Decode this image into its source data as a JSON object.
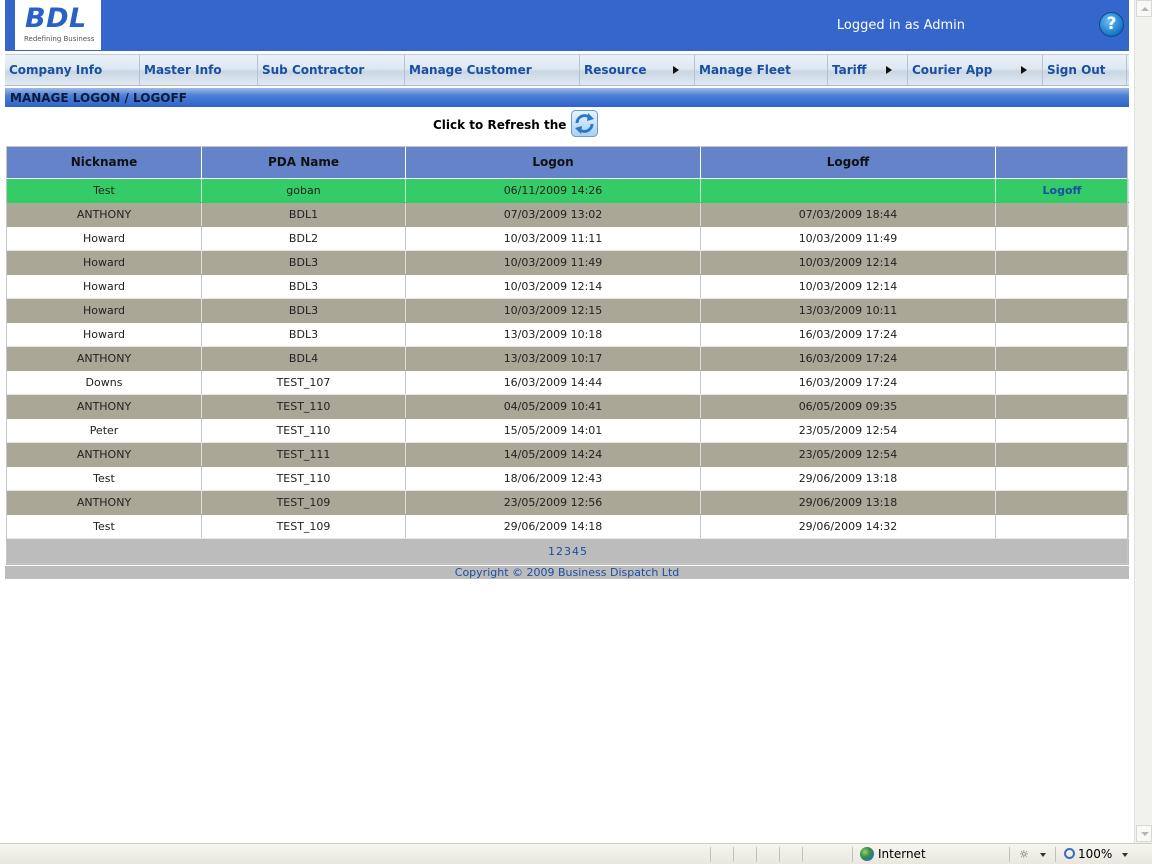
{
  "header": {
    "logo_text": "BDL",
    "logo_tagline": "Redefining Business",
    "logged_in_text": "Logged in as Admin",
    "help_label": "?"
  },
  "nav": {
    "items": [
      {
        "label": "Company Info",
        "has_submenu": false
      },
      {
        "label": "Master Info",
        "has_submenu": false
      },
      {
        "label": "Sub Contractor",
        "has_submenu": false
      },
      {
        "label": "Manage Customer",
        "has_submenu": false
      },
      {
        "label": "Resource",
        "has_submenu": true
      },
      {
        "label": "Manage Fleet",
        "has_submenu": false
      },
      {
        "label": "Tariff",
        "has_submenu": true
      },
      {
        "label": "Courier App",
        "has_submenu": true
      },
      {
        "label": "Sign Out",
        "has_submenu": false
      }
    ]
  },
  "page": {
    "title": "MANAGE LOGON / LOGOFF",
    "refresh_label": "Click to Refresh the List",
    "refresh_icon": "refresh-icon"
  },
  "table": {
    "columns": [
      "Nickname",
      "PDA Name",
      "Logon",
      "Logoff",
      ""
    ],
    "rows": [
      {
        "nickname": "Test",
        "pda": "goban",
        "logon": "06/11/2009 14:26",
        "logoff": "",
        "action": "Logoff"
      },
      {
        "nickname": "ANTHONY",
        "pda": "BDL1",
        "logon": "07/03/2009 13:02",
        "logoff": "07/03/2009 18:44",
        "action": ""
      },
      {
        "nickname": "Howard",
        "pda": "BDL2",
        "logon": "10/03/2009 11:11",
        "logoff": "10/03/2009 11:49",
        "action": ""
      },
      {
        "nickname": "Howard",
        "pda": "BDL3",
        "logon": "10/03/2009 11:49",
        "logoff": "10/03/2009 12:14",
        "action": ""
      },
      {
        "nickname": "Howard",
        "pda": "BDL3",
        "logon": "10/03/2009 12:14",
        "logoff": "10/03/2009 12:14",
        "action": ""
      },
      {
        "nickname": "Howard",
        "pda": "BDL3",
        "logon": "10/03/2009 12:15",
        "logoff": "13/03/2009 10:11",
        "action": ""
      },
      {
        "nickname": "Howard",
        "pda": "BDL3",
        "logon": "13/03/2009 10:18",
        "logoff": "16/03/2009 17:24",
        "action": ""
      },
      {
        "nickname": "ANTHONY",
        "pda": "BDL4",
        "logon": "13/03/2009 10:17",
        "logoff": "16/03/2009 17:24",
        "action": ""
      },
      {
        "nickname": "Downs",
        "pda": "TEST_107",
        "logon": "16/03/2009 14:44",
        "logoff": "16/03/2009 17:24",
        "action": ""
      },
      {
        "nickname": "ANTHONY",
        "pda": "TEST_110",
        "logon": "04/05/2009 10:41",
        "logoff": "06/05/2009 09:35",
        "action": ""
      },
      {
        "nickname": "Peter",
        "pda": "TEST_110",
        "logon": "15/05/2009 14:01",
        "logoff": "23/05/2009 12:54",
        "action": ""
      },
      {
        "nickname": "ANTHONY",
        "pda": "TEST_111",
        "logon": "14/05/2009 14:24",
        "logoff": "23/05/2009 12:54",
        "action": ""
      },
      {
        "nickname": "Test",
        "pda": "TEST_110",
        "logon": "18/06/2009 12:43",
        "logoff": "29/06/2009 13:18",
        "action": ""
      },
      {
        "nickname": "ANTHONY",
        "pda": "TEST_109",
        "logon": "23/05/2009 12:56",
        "logoff": "29/06/2009 13:18",
        "action": ""
      },
      {
        "nickname": "Test",
        "pda": "TEST_109",
        "logon": "29/06/2009 14:18",
        "logoff": "29/06/2009 14:32",
        "action": ""
      }
    ],
    "pages": [
      "1",
      "2",
      "3",
      "4",
      "5"
    ]
  },
  "footer": {
    "copyright": "Copyright © 2009 Business Dispatch Ltd"
  },
  "statusbar": {
    "zone": "Internet",
    "zoom": "100%"
  },
  "colors": {
    "header_bg": "#3566cc",
    "active_row": "#33cc66",
    "alt_row": "#aaa797",
    "table_header": "#6483c9",
    "link": "#1a4fa3"
  }
}
